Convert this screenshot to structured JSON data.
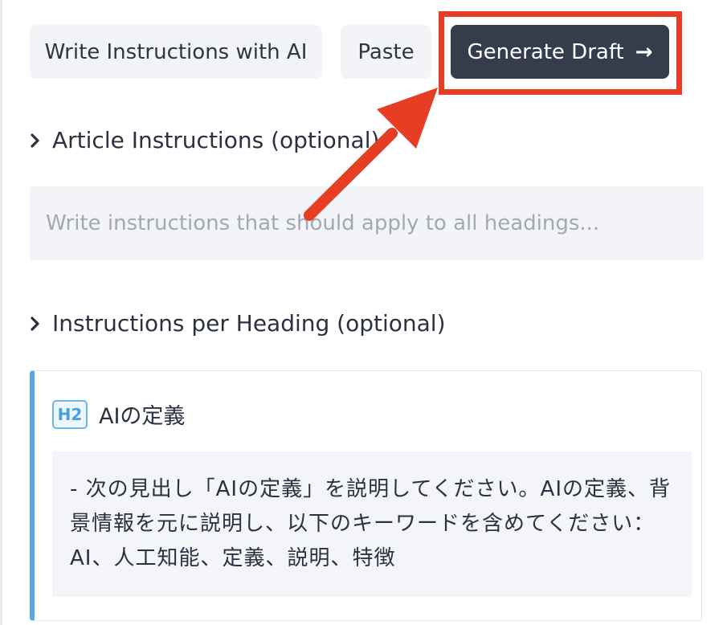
{
  "toolbar": {
    "write_ai_label": "Write Instructions with AI",
    "paste_label": "Paste",
    "generate_label": "Generate Draft",
    "generate_icon": "→"
  },
  "article": {
    "section_label": "Article Instructions (optional)",
    "placeholder": "Write instructions that should apply to all headings..."
  },
  "per_heading": {
    "section_label": "Instructions per Heading (optional)",
    "card": {
      "badge": "H2",
      "title": "AIの定義",
      "instructions": "- 次の見出し「AIの定義」を説明してください。AIの定義、背景情報を元に説明し、以下のキーワードを含めてください：AI、人工知能、定義、説明、特徴"
    }
  },
  "colors": {
    "annotation": "#e53e25",
    "primary_button": "#353d4d",
    "heading_accent": "#5aa8e4"
  },
  "icons": {
    "section_toggle": "chevron-right-icon",
    "generate": "arrow-right-icon"
  }
}
